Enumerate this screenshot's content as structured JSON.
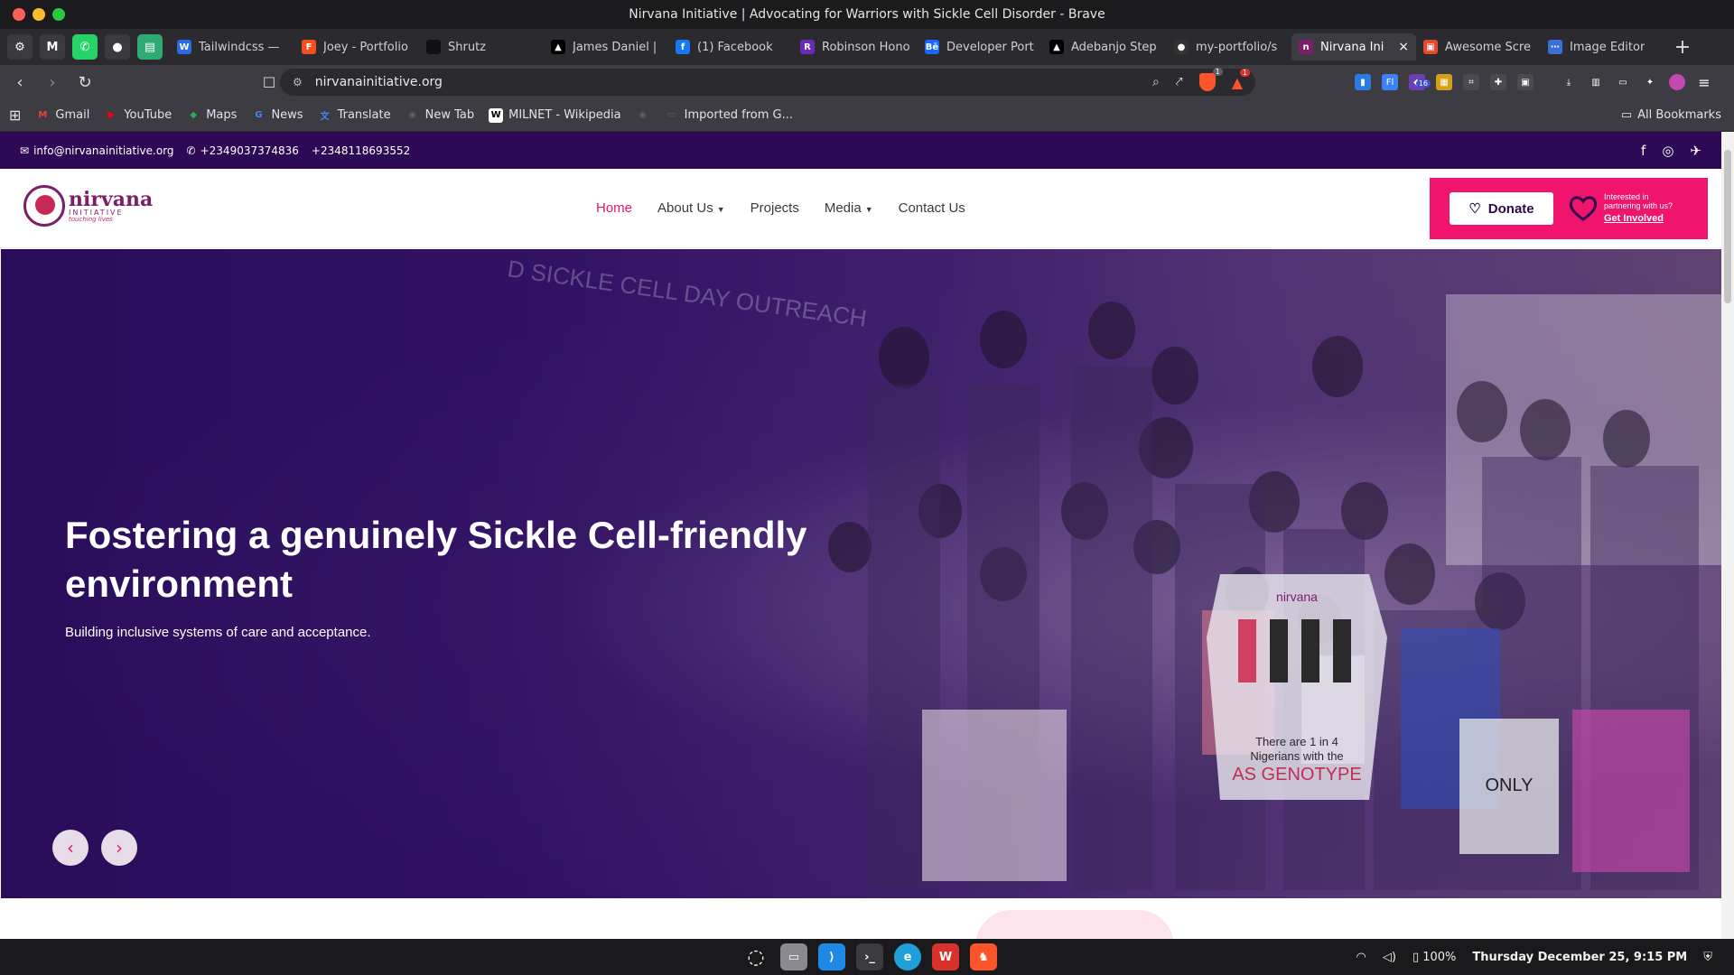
{
  "window": {
    "title": "Nirvana Initiative | Advocating for Warriors with Sickle Cell Disorder - Brave"
  },
  "tabs": [
    {
      "label": "Tailwindcss —",
      "icon": "word-icon",
      "color": "#2b6ce6",
      "glyph": "W"
    },
    {
      "label": "Joey - Portfolio",
      "icon": "figma-icon",
      "color": "#f24e1e",
      "glyph": "F"
    },
    {
      "label": "Shrutz",
      "icon": "dark-dot-icon",
      "color": "#111111",
      "glyph": ""
    },
    {
      "label": "James Daniel |",
      "icon": "triangle-icon",
      "color": "#000000",
      "glyph": "▲"
    },
    {
      "label": "(1) Facebook",
      "icon": "facebook-icon",
      "color": "#1877f2",
      "glyph": "f"
    },
    {
      "label": "Robinson Hono",
      "icon": "purple-square-icon",
      "color": "#6a2bb5",
      "glyph": "R"
    },
    {
      "label": "Developer Port",
      "icon": "behance-icon",
      "color": "#1769ff",
      "glyph": "Bē"
    },
    {
      "label": "Adebanjo Step",
      "icon": "triangle-icon",
      "color": "#000000",
      "glyph": "▲"
    },
    {
      "label": "my-portfolio/s",
      "icon": "github-icon",
      "color": "#333333",
      "glyph": "●"
    },
    {
      "label": "Nirvana Ini",
      "icon": "nirvana-icon",
      "color": "#7a1f6a",
      "glyph": "n",
      "active": true
    },
    {
      "label": "Awesome Scre",
      "icon": "screenshot-icon",
      "color": "#e34a2f",
      "glyph": "▣"
    },
    {
      "label": "Image Editor",
      "icon": "editor-icon",
      "color": "#3b6fd8",
      "glyph": "⋯"
    }
  ],
  "pinned": [
    {
      "name": "settings-pin-icon",
      "glyph": "⚙",
      "color": "#3a3a3f"
    },
    {
      "name": "gmail-pin-icon",
      "glyph": "M",
      "color": "#3a3a3f"
    },
    {
      "name": "whatsapp-pin-icon",
      "glyph": "✆",
      "color": "#25d366"
    },
    {
      "name": "github-pin-icon",
      "glyph": "●",
      "color": "#3a3a3f"
    },
    {
      "name": "notes-pin-icon",
      "glyph": "▤",
      "color": "#2faa72"
    }
  ],
  "toolbar": {
    "url": "nirvanainitiative.org",
    "shield_count": "1",
    "alert_count": "1",
    "ext_badge": "16"
  },
  "bookmarks": [
    {
      "label": "Gmail",
      "glyph": "M",
      "color": "#ea4335"
    },
    {
      "label": "YouTube",
      "glyph": "▶",
      "color": "#ff0000"
    },
    {
      "label": "Maps",
      "glyph": "◆",
      "color": "#34a853"
    },
    {
      "label": "News",
      "glyph": "G",
      "color": "#4285f4"
    },
    {
      "label": "Translate",
      "glyph": "文",
      "color": "#4285f4"
    },
    {
      "label": "New Tab",
      "glyph": "◉",
      "color": "#5f5f63"
    },
    {
      "label": "MILNET - Wikipedia",
      "glyph": "W",
      "color": "#ffffff"
    },
    {
      "label": "",
      "glyph": "◉",
      "color": "#5f5f63"
    },
    {
      "label": "Imported from G...",
      "glyph": "▭",
      "color": "#5f5f63"
    }
  ],
  "bookmarks_right": "All Bookmarks",
  "site": {
    "topbar": {
      "email": "info@nirvanainitiative.org",
      "phone1": "+2349037374836",
      "phone2": "+2348118693552"
    },
    "logo": {
      "name": "nirvana",
      "sub": "INITIATIVE",
      "tag": "touching lives"
    },
    "menu": {
      "home": "Home",
      "about": "About Us",
      "projects": "Projects",
      "media": "Media",
      "contact": "Contact Us"
    },
    "cta": {
      "donate": "Donate",
      "involve_line1": "Interested in",
      "involve_line2": "partnering with us?",
      "involve_link": "Get Involved"
    },
    "hero": {
      "title": "Fostering a genuinely Sickle Cell-friendly environment",
      "subtitle": "Building inclusive systems of care and acceptance.",
      "sign_line1": "nirvana",
      "sign_line2": "There are 1 in 4",
      "sign_line3": "Nigerians with the",
      "sign_line4": "AS GENOTYPE",
      "bag_text": "ONLY",
      "banner_text": "D SICKLE CELL DAY OUTREACH"
    }
  },
  "taskbar": {
    "battery": "100%",
    "datetime": "Thursday December 25, 9:15 PM"
  },
  "colors": {
    "brand_purple": "#2e0a56",
    "brand_pink": "#f0146c",
    "active_link": "#e8176d"
  }
}
